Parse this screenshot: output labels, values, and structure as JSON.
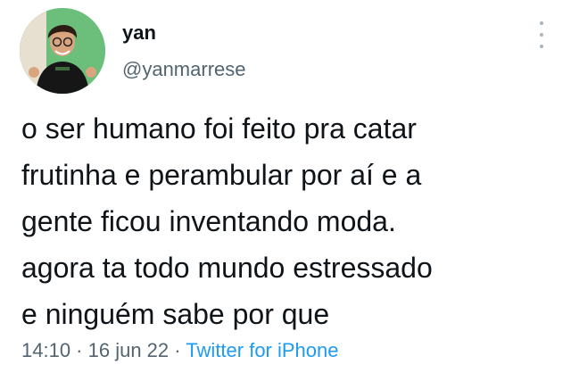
{
  "author": {
    "name": "yan",
    "handle": "@yanmarrese"
  },
  "tweet": {
    "lines": [
      "o ser humano foi feito pra catar",
      "frutinha e perambular por aí e a",
      "gente ficou inventando moda.",
      "agora ta todo mundo estressado",
      "e ninguém sabe por que"
    ]
  },
  "meta": {
    "time": "14:10",
    "separator": " · ",
    "date": "16 jun 22",
    "source": "Twitter for iPhone"
  },
  "icons": {
    "more": "more-vertical-icon"
  },
  "colors": {
    "text": "#0f1419",
    "secondary": "#536471",
    "link": "#1d9bf0"
  }
}
